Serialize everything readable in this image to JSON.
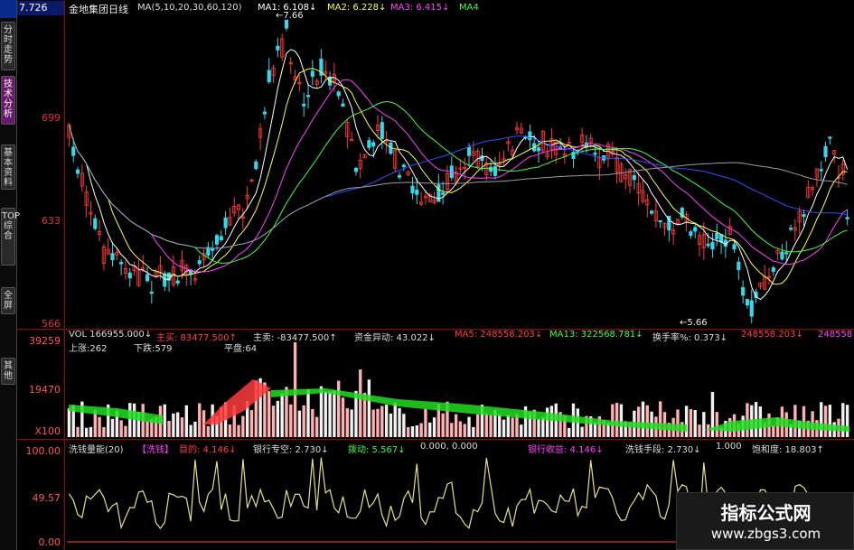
{
  "sidebar": {
    "tabs": [
      {
        "label": "分时走势",
        "active": false
      },
      {
        "label": "技术分析",
        "active": true
      },
      {
        "label": "基本资料",
        "active": false
      },
      {
        "label": "TOP综合",
        "active": false
      },
      {
        "label": "全屏",
        "active": false
      },
      {
        "label": "其他",
        "active": false
      }
    ]
  },
  "price_panel": {
    "current_price": "7.726",
    "stock_name": "金地集团日线",
    "ma_params": "MA(5,10,20,30,60,120)",
    "ma1": "MA1: 6.108↓",
    "ma2": "MA2: 6.228↓",
    "ma3": "MA3: 6.415↓",
    "ma4": "MA4",
    "y_labels": [
      "699",
      "633",
      "566"
    ],
    "high_label": "←7.66",
    "low_label": "←5.66"
  },
  "volume_panel": {
    "vol": "VOL 166955.000↓",
    "main_buy": "主买: 83477.500↑",
    "main_sell": "主卖: -83477.500↑",
    "fund_move": "资金异动: 43.022↓",
    "ma5": "MA5: 248558.203↓",
    "ma13": "MA13: 322568.781↓",
    "turnover": "换手率%: 0.373↓",
    "ma_val": "248558.203↓",
    "ma_val2": "248558",
    "up": "上涨:262",
    "down": "下跌:579",
    "flat": "平盘:64",
    "y_labels": [
      "39259",
      "19470",
      "X100"
    ]
  },
  "indicator_panel": {
    "name": "洗钱量能(20)",
    "tag": "【洗钱】",
    "target": "目的: 4.146↓",
    "bank_short": "银行专空: 2.730↓",
    "wash": "拨动: 5.567↓",
    "v0": "0.000, 0.000",
    "bank_gain": "银行收益: 4.146↓",
    "wash_means": "洗钱手段: 2.730↓",
    "v1": "1.000",
    "saturation": "饱和度: 18.803↑",
    "y_labels": [
      "100.00",
      "49.57",
      "0.00"
    ]
  },
  "watermark": {
    "title": "指标公式网",
    "url": "www.zbgs3.com"
  },
  "colors": {
    "up": "#ff3b3b",
    "down": "#38d6e8",
    "ma1": "#ffffff",
    "ma2": "#ffff40",
    "ma3": "#ff40ff",
    "ma4": "#40ff40",
    "ma5": "#3050ff",
    "line": "#e6e08a"
  }
}
